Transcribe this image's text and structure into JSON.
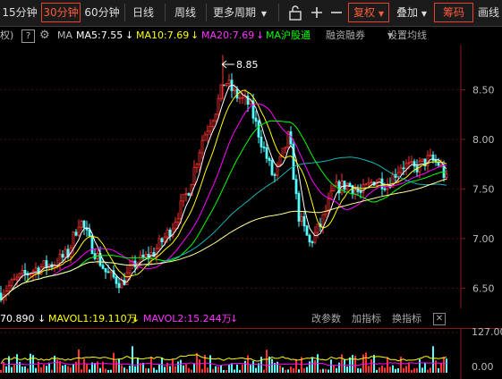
{
  "toolbar": {
    "periods": [
      {
        "label": "15分钟",
        "active": false
      },
      {
        "label": "30分钟",
        "active": true
      },
      {
        "label": "60分钟",
        "active": false
      },
      {
        "label": "日线",
        "active": false
      },
      {
        "label": "周线",
        "active": false
      },
      {
        "label": "更多周期",
        "active": false
      }
    ],
    "fuquan_label": "复权",
    "diejia_label": "叠加",
    "chouma_label": "筹码",
    "huajing_label": "画线"
  },
  "indicator_bar": {
    "fuquan_short": "权)",
    "help": "?",
    "ma_label": "MA",
    "ma5": "MA5:7.55",
    "ma10": "MA10:7.69",
    "ma20": "MA20:7.69",
    "ma_hgt": "MA沪股通",
    "rongzi": "融资融券",
    "shezhi": "设置均线"
  },
  "price_axis": [
    "8.50",
    "8.00",
    "7.50",
    "7.00",
    "6.50"
  ],
  "high_marker": "8.85",
  "volume_bar": {
    "vol": "70.890",
    "mavol1": "MAVOL1:19.110万",
    "mavol2": "MAVOL2:15.244万",
    "gai": "改参数",
    "add": "加指标",
    "swap": "换指标"
  },
  "volume_axis": [
    "127.00",
    "0.00"
  ],
  "colors": {
    "up": "#ff3232",
    "down": "#54ffff",
    "ma5": "#ffffff",
    "ma10": "#ffff00",
    "ma20": "#ff00ff",
    "ma30": "#00ff00",
    "ma60": "#14b4b4",
    "ma120": "#ffff99",
    "accent": "#e8402a"
  },
  "chart_data": {
    "type": "candlestick",
    "ylim": [
      6.35,
      8.9
    ],
    "high": 8.85,
    "ma5_last": 7.55,
    "ma10_last": 7.69,
    "ma20_last": 7.69,
    "vol_last": 70.89,
    "mavol1_last": 191100,
    "mavol2_last": 152440,
    "vol_max": 127.0,
    "vol_min": 0.0
  }
}
